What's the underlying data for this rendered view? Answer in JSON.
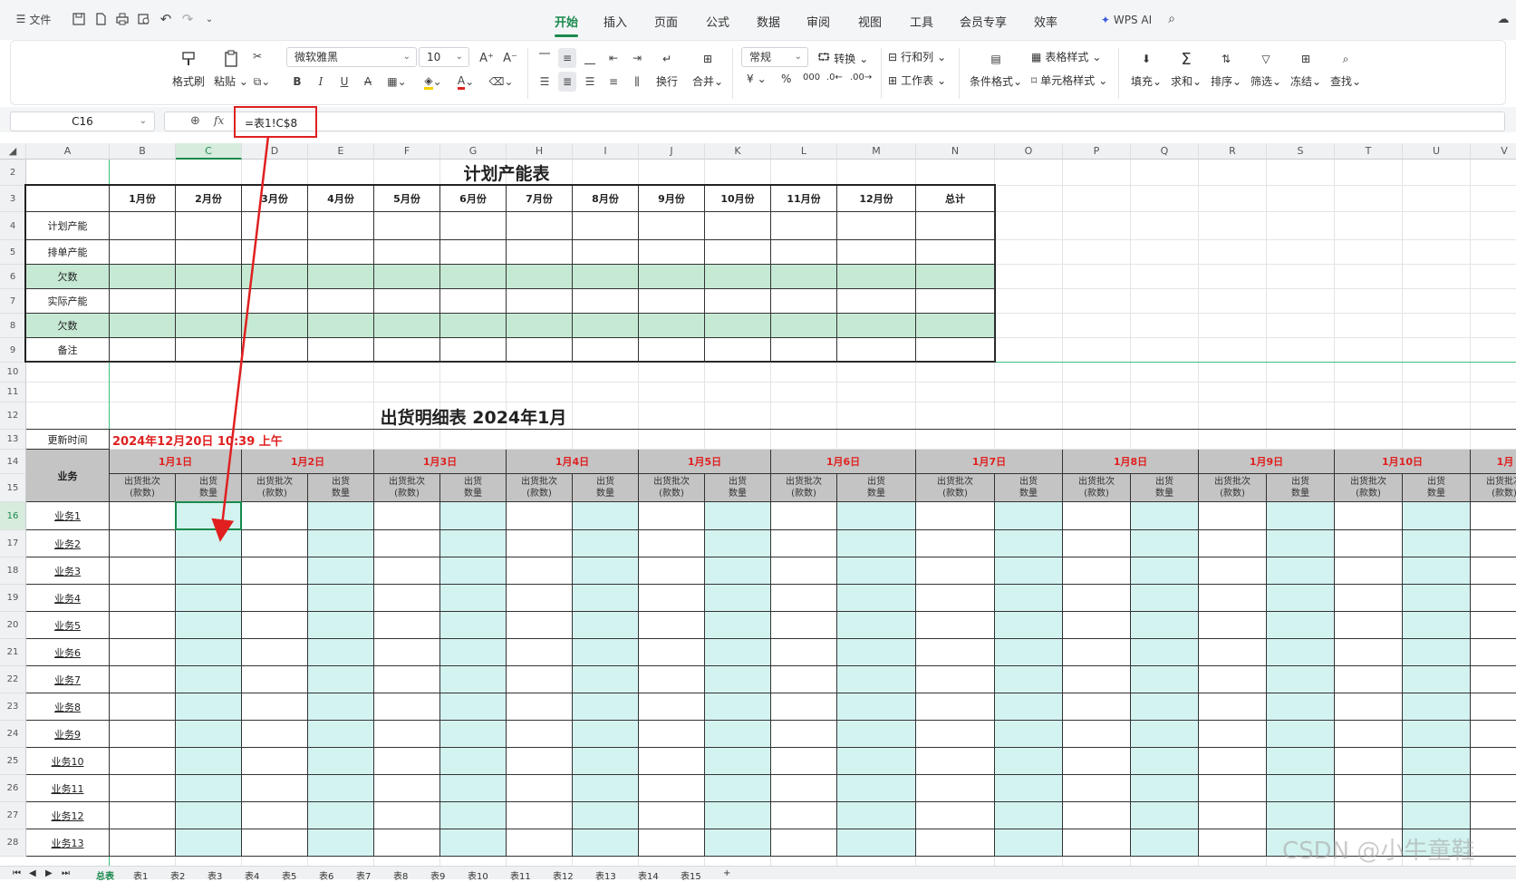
{
  "menubar": {
    "file_label": "文件",
    "tabs": [
      "开始",
      "插入",
      "页面",
      "公式",
      "数据",
      "审阅",
      "视图",
      "工具",
      "会员专享",
      "效率"
    ],
    "active_tab": "开始",
    "wps_ai": "WPS AI"
  },
  "ribbon": {
    "format_painter": "格式刷",
    "paste": "粘贴",
    "font_name": "微软雅黑",
    "font_size": "10",
    "wrap": "换行",
    "merge": "合并",
    "number_format": "常规",
    "convert": "转换",
    "row_col": "行和列",
    "worksheet": "工作表",
    "cond_format": "条件格式",
    "table_style": "表格样式",
    "cell_style": "单元格样式",
    "fill": "填充",
    "sum": "求和",
    "sort": "排序",
    "filter": "筛选",
    "freeze": "冻结",
    "find": "查找",
    "currency": "¥",
    "percent": "%"
  },
  "formula_bar": {
    "name_box": "C16",
    "fx": "fx",
    "formula": "=表1!C$8"
  },
  "columns": [
    "A",
    "B",
    "C",
    "D",
    "E",
    "F",
    "G",
    "H",
    "I",
    "J",
    "K",
    "L",
    "M",
    "N",
    "O",
    "P",
    "Q",
    "R",
    "S",
    "T",
    "U",
    "V"
  ],
  "rows": [
    "2",
    "3",
    "4",
    "5",
    "6",
    "7",
    "8",
    "9",
    "10",
    "11",
    "12",
    "13",
    "14",
    "15",
    "16",
    "17",
    "18",
    "19",
    "20",
    "21",
    "22",
    "23",
    "24",
    "25",
    "26",
    "27",
    "28"
  ],
  "table1": {
    "title": "计划产能表",
    "headers": [
      "1月份",
      "2月份",
      "3月份",
      "4月份",
      "5月份",
      "6月份",
      "7月份",
      "8月份",
      "9月份",
      "10月份",
      "11月份",
      "12月份",
      "总计"
    ],
    "row_labels": [
      "计划产能",
      "排单产能",
      "欠数",
      "实际产能",
      "欠数",
      "备注"
    ]
  },
  "table2": {
    "title": "出货明细表 2024年1月",
    "update_label": "更新时间",
    "update_value": "2024年12月20日 10:39 上午",
    "business_label": "业务",
    "dates": [
      "1月1日",
      "1月2日",
      "1月3日",
      "1月4日",
      "1月5日",
      "1月6日",
      "1月7日",
      "1月8日",
      "1月9日",
      "1月10日",
      "1月"
    ],
    "sub_batch": [
      "出货批次",
      "(款数)"
    ],
    "sub_qty": [
      "出货",
      "数量"
    ],
    "businesses": [
      "业务1",
      "业务2",
      "业务3",
      "业务4",
      "业务5",
      "业务6",
      "业务7",
      "业务8",
      "业务9",
      "业务10",
      "业务11",
      "业务12",
      "业务13"
    ]
  },
  "sheet_tabs": [
    "总表",
    "表1",
    "表2",
    "表3",
    "表4",
    "表5",
    "表6",
    "表7",
    "表8",
    "表9",
    "表10",
    "表11",
    "表12",
    "表13",
    "表14",
    "表15"
  ],
  "active_sheet": "总表",
  "watermark": "CSDN @小牛童鞋",
  "accent_color": "#1a8a4d",
  "highlight_color": "#e02020"
}
